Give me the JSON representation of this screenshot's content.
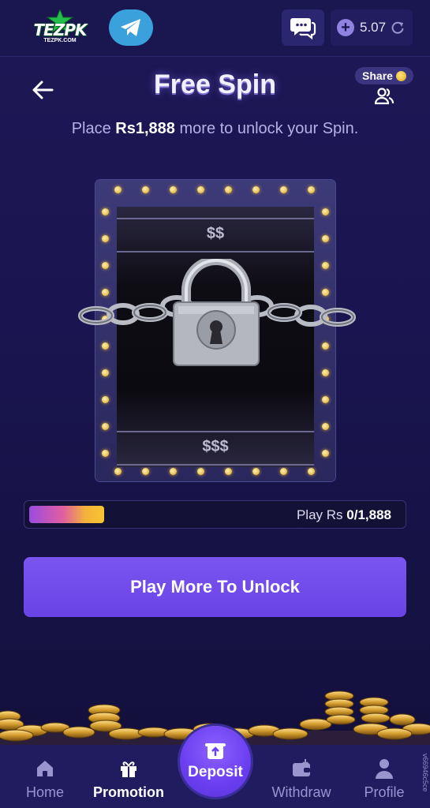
{
  "topbar": {
    "logo_text": "TEZPK",
    "logo_sub": "TEZPK.COM",
    "balance": "5.07"
  },
  "header": {
    "title": "Free Spin",
    "share_label": "Share"
  },
  "subtitle": {
    "prefix": "Place",
    "currency": "Rs",
    "amount": "1,888",
    "suffix": "more to unlock your Spin."
  },
  "machine": {
    "top_reel_label": "$$",
    "bottom_reel_label": "$$$"
  },
  "progress": {
    "label_prefix": "Play Rs",
    "current_total": "0/1,888",
    "fill_fraction": 0.2
  },
  "cta": {
    "label": "Play More To Unlock"
  },
  "bottom_nav": {
    "items": [
      {
        "label": "Home",
        "icon": "home-icon"
      },
      {
        "label": "Promotion",
        "icon": "gift-icon"
      },
      {
        "label": "Deposit",
        "icon": "deposit-icon"
      },
      {
        "label": "Withdraw",
        "icon": "wallet-icon"
      },
      {
        "label": "Profile",
        "icon": "profile-icon"
      }
    ],
    "active": "Promotion"
  },
  "version": "v66946c5ce",
  "colors": {
    "background": "#1a1550",
    "accent": "#6a43e6",
    "progress_gold": "#f7c531"
  }
}
